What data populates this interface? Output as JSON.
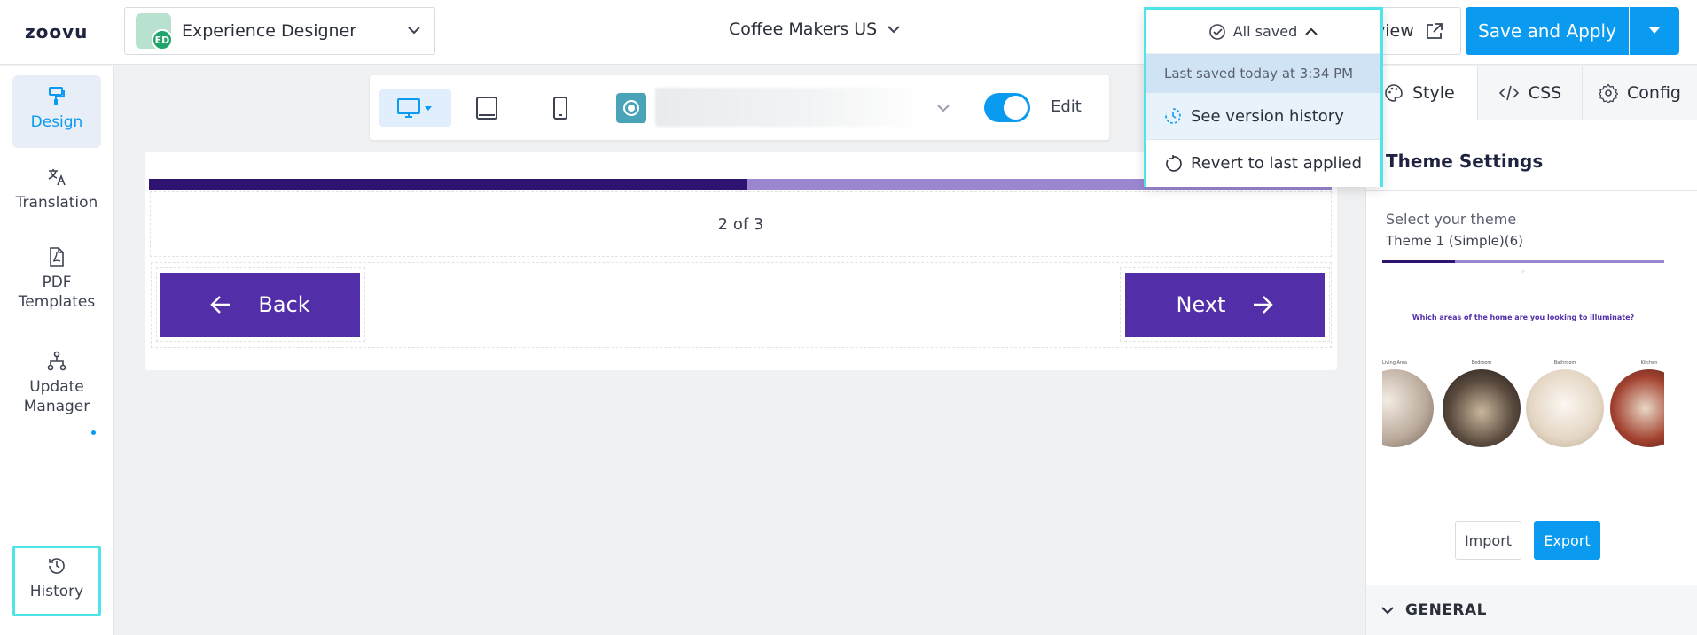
{
  "header": {
    "logo": "zoovu",
    "app_name": "Experience Designer",
    "app_badge": "ED",
    "project": "Coffee Makers US",
    "preview_label": "view",
    "save_apply": "Save and Apply"
  },
  "save_dropdown": {
    "status": "All saved",
    "last_saved": "Last saved today at 3:34 PM",
    "see_history": "See version history",
    "revert": "Revert to last applied"
  },
  "sidebar": {
    "items": [
      {
        "label": "Design"
      },
      {
        "label": "Translation"
      },
      {
        "label": "PDF Templates"
      },
      {
        "label": "Update Manager"
      },
      {
        "label": "History"
      }
    ]
  },
  "toolbar": {
    "edit_label": "Edit",
    "edit_enabled": true
  },
  "canvas": {
    "progress": 0.505,
    "page_text": "2 of 3",
    "back_label": "Back",
    "next_label": "Next"
  },
  "panel": {
    "tabs": [
      {
        "label": "Style"
      },
      {
        "label": "CSS"
      },
      {
        "label": "Config"
      }
    ],
    "theme_settings": "Theme Settings",
    "select_theme": "Select your theme",
    "theme_name": "Theme 1 (Simple)(6)",
    "thumb_question": "Which areas of the home are you looking to illuminate?",
    "thumb_rooms": [
      "Living Area",
      "Bedroom",
      "Bathroom",
      "Kitchen"
    ],
    "import_label": "Import",
    "export_label": "Export",
    "general_label": "GENERAL"
  },
  "colors": {
    "accent": "#0a9bf0",
    "brand_purple": "#522ea8",
    "highlight": "#4fe3ea"
  }
}
